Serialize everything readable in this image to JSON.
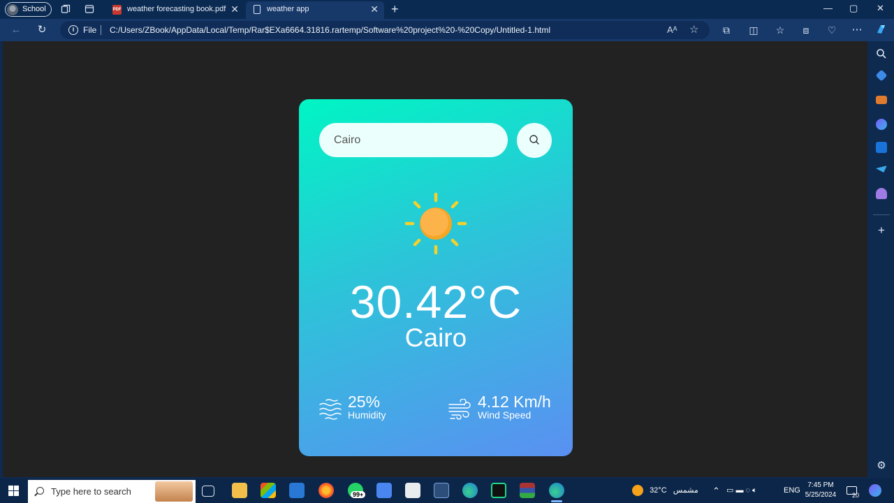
{
  "browser": {
    "profile_label": "School",
    "tabs": [
      {
        "label": "weather forecasting book.pdf",
        "icon": "pdf-icon",
        "active": false
      },
      {
        "label": "weather app",
        "icon": "document-icon",
        "active": true
      }
    ],
    "new_tab_symbol": "+",
    "address": {
      "scheme": "File",
      "url": "C:/Users/ZBook/AppData/Local/Temp/Rar$EXa6664.31816.rartemp/Software%20project%20-%20Copy/Untitled-1.html"
    }
  },
  "app": {
    "search": {
      "value": "Cairo",
      "placeholder": ""
    },
    "weather_icon": "sun-icon",
    "temperature": "30.42°C",
    "city": "Cairo",
    "humidity": {
      "value": "25%",
      "label": "Humidity",
      "icon": "humidity-icon"
    },
    "wind": {
      "value": "4.12 Km/h",
      "label": "Wind Speed",
      "icon": "wind-icon"
    },
    "colors": {
      "gradient_start": "#00f5c4",
      "gradient_end": "#5a90f2",
      "sun": "#f9b233",
      "sun_rays": "#f6d12a"
    }
  },
  "taskbar": {
    "search_placeholder": "Type here to search",
    "notification_badge": "99+",
    "weather": {
      "temp": "32°C",
      "condition": "مشمس"
    },
    "language": "ENG",
    "time": "7:45 PM",
    "date": "5/25/2024",
    "notifications_count": "20"
  }
}
